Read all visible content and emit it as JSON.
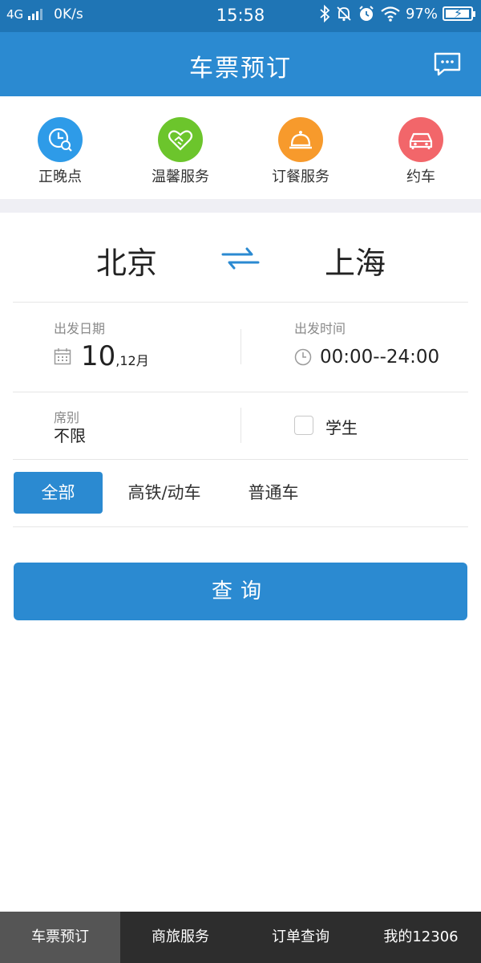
{
  "status_bar": {
    "network": "4G",
    "speed": "0K/s",
    "time": "15:58",
    "battery": "97%",
    "battery_level": 0.97
  },
  "header": {
    "title": "车票预订",
    "message_icon": "message-icon"
  },
  "services": [
    {
      "label": "正晚点",
      "icon": "clock-search-icon",
      "color": "#2e9be8"
    },
    {
      "label": "温馨服务",
      "icon": "heart-handshake-icon",
      "color": "#6cc52c"
    },
    {
      "label": "订餐服务",
      "icon": "dining-bell-icon",
      "color": "#f79a2c"
    },
    {
      "label": "约车",
      "icon": "car-icon",
      "color": "#f2666a"
    }
  ],
  "route": {
    "from": "北京",
    "to": "上海"
  },
  "date": {
    "label": "出发日期",
    "day": "10",
    "month": ",12月"
  },
  "time": {
    "label": "出发时间",
    "value": "00:00--24:00"
  },
  "seat": {
    "label": "席别",
    "value": "不限"
  },
  "student": {
    "label": "学生",
    "checked": false
  },
  "train_types": [
    {
      "label": "全部",
      "active": true
    },
    {
      "label": "高铁/动车",
      "active": false
    },
    {
      "label": "普通车",
      "active": false
    }
  ],
  "query_button": "查询",
  "bottom_nav": [
    {
      "label": "车票预订",
      "active": true
    },
    {
      "label": "商旅服务",
      "active": false
    },
    {
      "label": "订单查询",
      "active": false
    },
    {
      "label": "我的12306",
      "active": false
    }
  ],
  "colors": {
    "primary": "#2b8ad1",
    "status_bar": "#1f75b5",
    "bottom_nav": "#2d2d2d"
  }
}
